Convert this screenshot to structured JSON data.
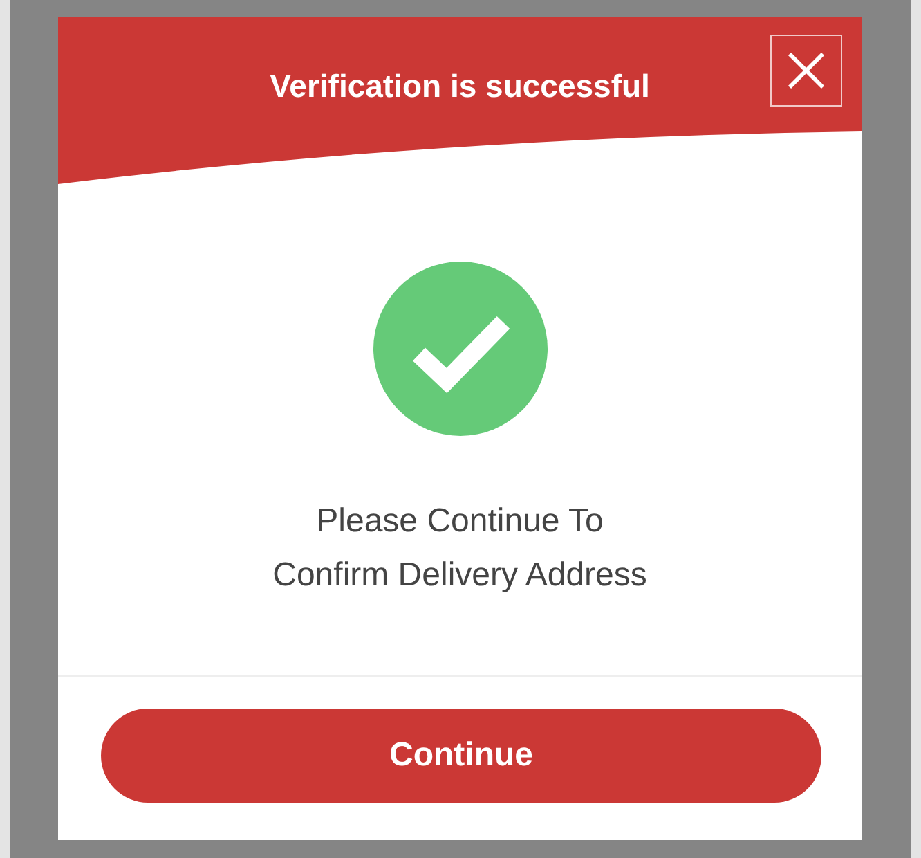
{
  "dialog": {
    "title": "Verification is successful",
    "message": [
      "Please Continue To",
      "Confirm Delivery Address"
    ],
    "button": "Continue"
  }
}
